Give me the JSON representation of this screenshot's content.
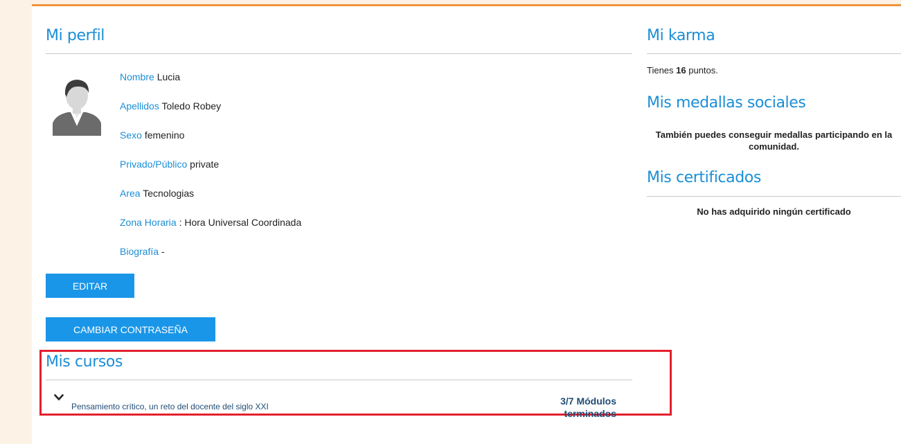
{
  "profile": {
    "title": "Mi perfil",
    "avatar_icon": "user-avatar-icon",
    "fields": [
      {
        "label": "Nombre",
        "value": "Lucia"
      },
      {
        "label": "Apellidos",
        "value": "Toledo Robey"
      },
      {
        "label": "Sexo",
        "value": "femenino"
      },
      {
        "label": "Privado/Público",
        "value": "private"
      },
      {
        "label": "Area",
        "value": "Tecnologias"
      },
      {
        "label": "Zona Horaria",
        "value": " : Hora Universal Coordinada"
      },
      {
        "label": "Biografía",
        "value": " -"
      }
    ],
    "edit_button": "EDITAR",
    "change_password_button": "CAMBIAR CONTRASEÑA"
  },
  "courses": {
    "title": "Mis cursos",
    "items": [
      {
        "name": "Pensamiento crítico, un reto del docente del siglo XXI",
        "progress_line1": "3/7 Módulos",
        "progress_line2": "terminados"
      }
    ]
  },
  "karma": {
    "title": "Mi karma",
    "text_prefix": "Tienes ",
    "points": "16",
    "text_suffix": " puntos."
  },
  "medals": {
    "title": "Mis medallas sociales",
    "note": "También puedes conseguir medallas participando en la comunidad."
  },
  "certificates": {
    "title": "Mis certificados",
    "note": "No has adquirido ningún certificado"
  },
  "colors": {
    "accent": "#1a8ed6",
    "button": "#1a96e8",
    "top_line": "#f0933a",
    "highlight": "#e3202e",
    "course_text": "#1f4c75"
  }
}
